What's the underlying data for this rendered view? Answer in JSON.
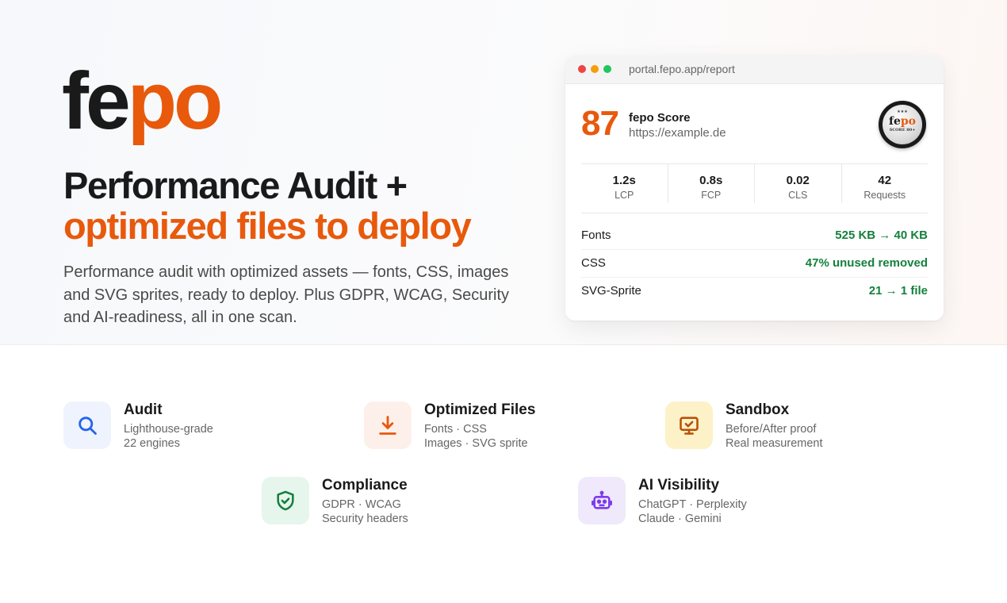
{
  "colors": {
    "accent": "#e8590c",
    "success": "#15803d",
    "text": "#1a1a1a",
    "muted": "#666666"
  },
  "hero": {
    "logo_part1": "fe",
    "logo_part2": "po",
    "headline_line1": "Performance Audit +",
    "headline_line2": "optimized files to deploy",
    "description": "Performance audit with optimized assets — fonts, CSS, images and SVG sprites, ready to deploy. Plus GDPR, WCAG, Security and AI-readiness, all in one scan."
  },
  "report_card": {
    "url": "portal.fepo.app/report",
    "score": "87",
    "score_label": "fepo Score",
    "site": "https://example.de",
    "seal": {
      "stars": "★★★",
      "brand_part1": "fe",
      "brand_part2": "po",
      "subtext": "SCORE 80+"
    },
    "metrics": [
      {
        "value": "1.2s",
        "label": "LCP"
      },
      {
        "value": "0.8s",
        "label": "FCP"
      },
      {
        "value": "0.02",
        "label": "CLS"
      },
      {
        "value": "42",
        "label": "Requests"
      }
    ],
    "rows": [
      {
        "label": "Fonts",
        "value": "525 KB → 40 KB"
      },
      {
        "label": "CSS",
        "value": "47% unused removed"
      },
      {
        "label": "SVG-Sprite",
        "value": "21 → 1 file"
      }
    ]
  },
  "features": [
    {
      "title": "Audit",
      "line1": "Lighthouse-grade",
      "line2": "22 engines",
      "icon": "search-icon",
      "icon_bg": "#eef3fe",
      "icon_color": "#2563eb"
    },
    {
      "title": "Optimized Files",
      "line1": "Fonts · CSS",
      "line2": "Images · SVG sprite",
      "icon": "download-icon",
      "icon_bg": "#fdf0eb",
      "icon_color": "#e8590c"
    },
    {
      "title": "Sandbox",
      "line1": "Before/After proof",
      "line2": "Real measurement",
      "icon": "monitor-check-icon",
      "icon_bg": "#fdf1c8",
      "icon_color": "#b45309"
    },
    {
      "title": "Compliance",
      "line1": "GDPR · WCAG",
      "line2": "Security headers",
      "icon": "shield-check-icon",
      "icon_bg": "#e6f6ec",
      "icon_color": "#15803d"
    },
    {
      "title": "AI Visibility",
      "line1": "ChatGPT · Perplexity",
      "line2": "Claude · Gemini",
      "icon": "robot-icon",
      "icon_bg": "#efe9fb",
      "icon_color": "#7c3aed"
    }
  ]
}
